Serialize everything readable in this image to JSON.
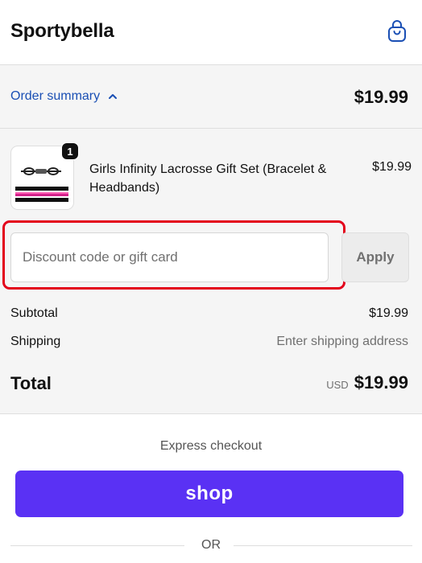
{
  "header": {
    "brand": "Sportybella",
    "cart_icon": "shopping-bag-icon"
  },
  "summary_bar": {
    "toggle_label": "Order summary",
    "toggle_icon": "chevron-up-icon",
    "total": "$19.99"
  },
  "product": {
    "name": "Girls Infinity Lacrosse Gift Set (Bracelet & Headbands)",
    "price": "$19.99",
    "quantity": "1"
  },
  "discount": {
    "placeholder": "Discount code or gift card",
    "value": "",
    "apply_label": "Apply"
  },
  "totals": {
    "subtotal_label": "Subtotal",
    "subtotal_value": "$19.99",
    "shipping_label": "Shipping",
    "shipping_value": "Enter shipping address",
    "total_label": "Total",
    "currency": "USD",
    "total_value": "$19.99"
  },
  "express": {
    "title": "Express checkout",
    "shop_label": "shop",
    "divider_text": "OR"
  },
  "colors": {
    "link": "#1a4fb4",
    "shop_purple": "#5a31f4",
    "highlight_red": "#e3001b",
    "panel_bg": "#f5f5f5"
  }
}
